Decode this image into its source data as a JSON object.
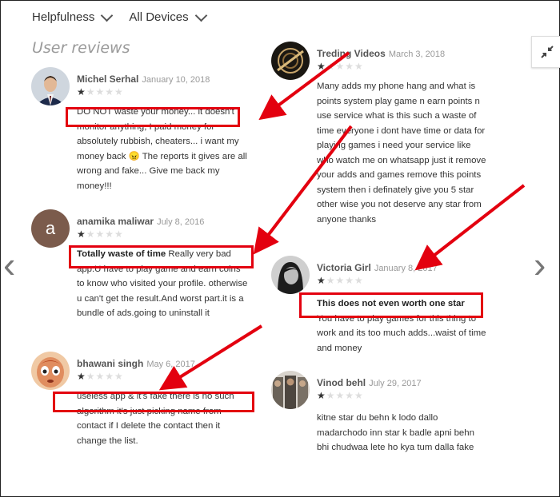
{
  "filters": {
    "sort_label": "Helpfulness",
    "device_label": "All Devices"
  },
  "section_title": "User reviews",
  "reviews": [
    {
      "name": "Michel Serhal",
      "date": "January 10, 2018",
      "rating": 1,
      "headline": "",
      "text": "DO NOT waste your money... it doesn't monitor anything, I paid money for absolutely rubbish, cheaters... i want my money back 😠 The reports it gives are all wrong and fake... Give me back my money!!!"
    },
    {
      "name": "anamika maliwar",
      "date": "July 8, 2016",
      "rating": 1,
      "headline": "Totally waste of time",
      "text": "Really very bad app.U have to play game and earn coins to know who visited your profile. otherwise u can't get the result.And worst part.it is a bundle of ads.going to uninstall it",
      "avatar_letter": "a"
    },
    {
      "name": "bhawani singh",
      "date": "May 6, 2017",
      "rating": 1,
      "headline": "",
      "text": "useless app & it's fake there is no such algorithm it's just picking name from contact if I delete the contact then it change the list."
    },
    {
      "name": "Treding Videos",
      "date": "March 3, 2018",
      "rating": 1,
      "headline": "",
      "text": "Many adds my phone hang and what is points system play game n earn points n use service what is this such a waste of time everyone i dont have time or data for playing games i need your service like who watch me on whatsapp just it remove your adds and games remove this points system then i definately give you 5 star other wise you not deserve any star from anyone thanks"
    },
    {
      "name": "Victoria Girl",
      "date": "January 8, 2017",
      "rating": 1,
      "headline": "This does not even worth one star",
      "text": "You have to play games for this thing to work and its too much adds...waist of time and money"
    },
    {
      "name": "Vinod behl",
      "date": "July 29, 2017",
      "rating": 1,
      "headline": "",
      "text": "kitne star du behn k lodo dallo madarchodo inn star k badle apni behn bhi chudwaa lete ho kya tum dalla fake"
    }
  ]
}
